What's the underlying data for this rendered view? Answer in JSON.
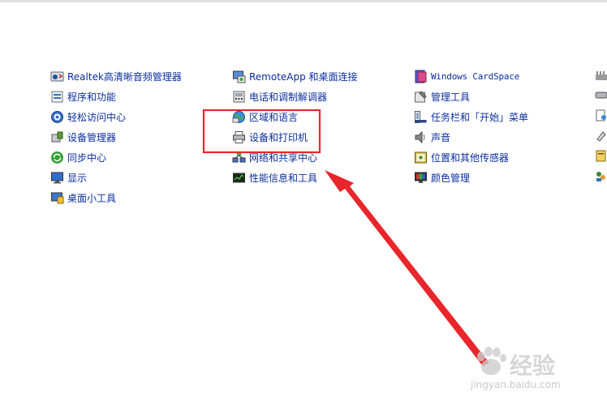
{
  "control_panel": {
    "column1": [
      {
        "label": "Realtek高清晰音频管理器",
        "icon": "speaker-icon"
      },
      {
        "label": "程序和功能",
        "icon": "programs-icon"
      },
      {
        "label": "轻松访问中心",
        "icon": "ease-of-access-icon"
      },
      {
        "label": "设备管理器",
        "icon": "device-manager-icon"
      },
      {
        "label": "同步中心",
        "icon": "sync-icon"
      },
      {
        "label": "显示",
        "icon": "display-icon"
      },
      {
        "label": "桌面小工具",
        "icon": "gadgets-icon"
      }
    ],
    "column2": [
      {
        "label": "RemoteApp 和桌面连接",
        "icon": "remoteapp-icon"
      },
      {
        "label": "电话和调制解调器",
        "icon": "phone-modem-icon"
      },
      {
        "label": "区域和语言",
        "icon": "region-language-icon"
      },
      {
        "label": "设备和打印机",
        "icon": "printer-icon"
      },
      {
        "label": "网络和共享中心",
        "icon": "network-icon"
      },
      {
        "label": "性能信息和工具",
        "icon": "performance-icon"
      }
    ],
    "column3": [
      {
        "label": "Windows CardSpace",
        "icon": "cardspace-icon"
      },
      {
        "label": "管理工具",
        "icon": "admin-tools-icon"
      },
      {
        "label": "任务栏和「开始」菜单",
        "icon": "taskbar-icon"
      },
      {
        "label": "声音",
        "icon": "sound-icon"
      },
      {
        "label": "位置和其他传感器",
        "icon": "sensor-icon"
      },
      {
        "label": "颜色管理",
        "icon": "color-management-icon"
      }
    ]
  },
  "annotation": {
    "highlight_color": "#e8262b",
    "arrow_color": "#e8262b"
  },
  "watermark": {
    "brand": "经验",
    "url": "jingyan.baidu.com"
  }
}
